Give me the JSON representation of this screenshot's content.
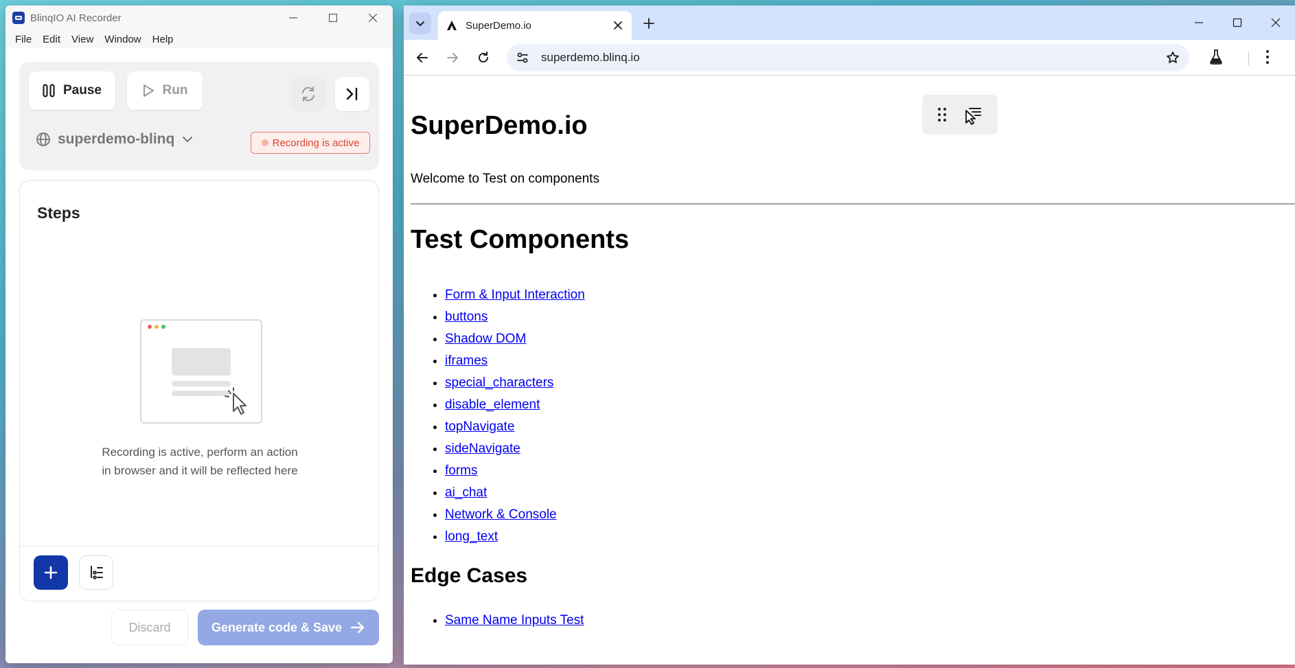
{
  "app": {
    "title": "BlinqIO AI Recorder",
    "menu": [
      "File",
      "Edit",
      "View",
      "Window",
      "Help"
    ],
    "pause_label": "Pause",
    "run_label": "Run",
    "project": "superdemo-blinq",
    "recording_badge": "Recording is active",
    "steps_title": "Steps",
    "empty_line1": "Recording is active, perform an action",
    "empty_line2": "in browser and it will be reflected here",
    "discard_label": "Discard",
    "generate_label": "Generate code & Save",
    "colors": {
      "primary": "#1237a8",
      "generate_disabled": "#93a8e4",
      "recording": "#d9442f"
    }
  },
  "browser": {
    "tab_title": "SuperDemo.io",
    "url": "superdemo.blinq.io"
  },
  "page": {
    "title": "SuperDemo.io",
    "welcome": "Welcome to Test on components",
    "section1": "Test Components",
    "links": [
      "Form & Input Interaction",
      "buttons",
      "Shadow DOM",
      "iframes",
      "special_characters",
      "disable_element",
      "topNavigate",
      "sideNavigate",
      "forms",
      "ai_chat",
      "Network & Console",
      "long_text"
    ],
    "section2": "Edge Cases",
    "edge_links": [
      "Same Name Inputs Test"
    ]
  }
}
